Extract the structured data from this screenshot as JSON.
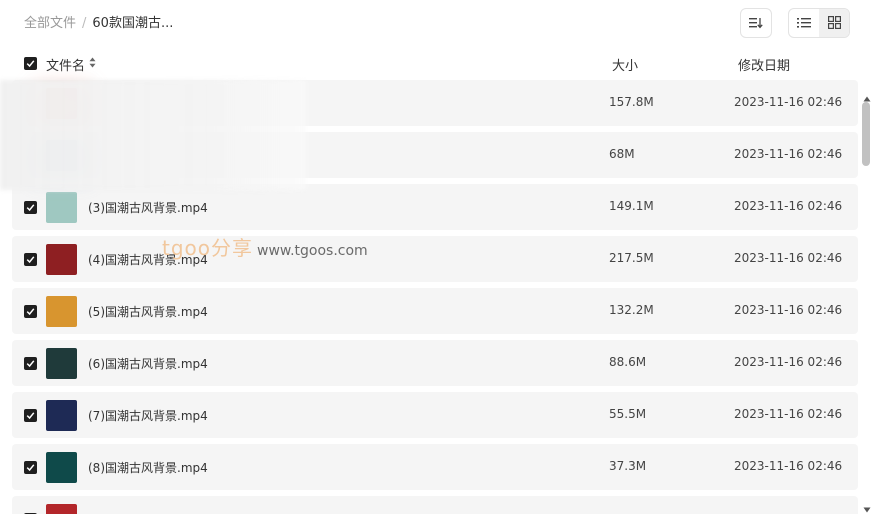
{
  "breadcrumb": {
    "root": "全部文件",
    "separator": "/",
    "current": "60款国潮古..."
  },
  "toolbar": {
    "sort_icon": "sort-icon",
    "list_view_icon": "list-view-icon",
    "grid_view_icon": "grid-view-icon",
    "active_view": "grid"
  },
  "columns": {
    "name": "文件名",
    "size": "大小",
    "modified": "修改日期"
  },
  "files": [
    {
      "name": "",
      "size": "157.8M",
      "date": "2023-11-16 02:46",
      "checked": false,
      "thumb_color": "#e6a79b"
    },
    {
      "name": "",
      "size": "68M",
      "date": "2023-11-16 02:46",
      "checked": false,
      "thumb_color": "#a9bcd6"
    },
    {
      "name": "(3)国潮古风背景.mp4",
      "size": "149.1M",
      "date": "2023-11-16 02:46",
      "checked": true,
      "thumb_color": "#9fc8c1"
    },
    {
      "name": "(4)国潮古风背景.mp4",
      "size": "217.5M",
      "date": "2023-11-16 02:46",
      "checked": true,
      "thumb_color": "#8e1f22"
    },
    {
      "name": "(5)国潮古风背景.mp4",
      "size": "132.2M",
      "date": "2023-11-16 02:46",
      "checked": true,
      "thumb_color": "#d8952f"
    },
    {
      "name": "(6)国潮古风背景.mp4",
      "size": "88.6M",
      "date": "2023-11-16 02:46",
      "checked": true,
      "thumb_color": "#1f3a3a"
    },
    {
      "name": "(7)国潮古风背景.mp4",
      "size": "55.5M",
      "date": "2023-11-16 02:46",
      "checked": true,
      "thumb_color": "#1e2a55"
    },
    {
      "name": "(8)国潮古风背景.mp4",
      "size": "37.3M",
      "date": "2023-11-16 02:46",
      "checked": true,
      "thumb_color": "#0f4a4a"
    },
    {
      "name": "",
      "size": "",
      "date": "",
      "checked": true,
      "thumb_color": "#b3262a"
    }
  ],
  "watermark": {
    "logo": "tgoo分享",
    "url": "www.tgoos.com"
  }
}
